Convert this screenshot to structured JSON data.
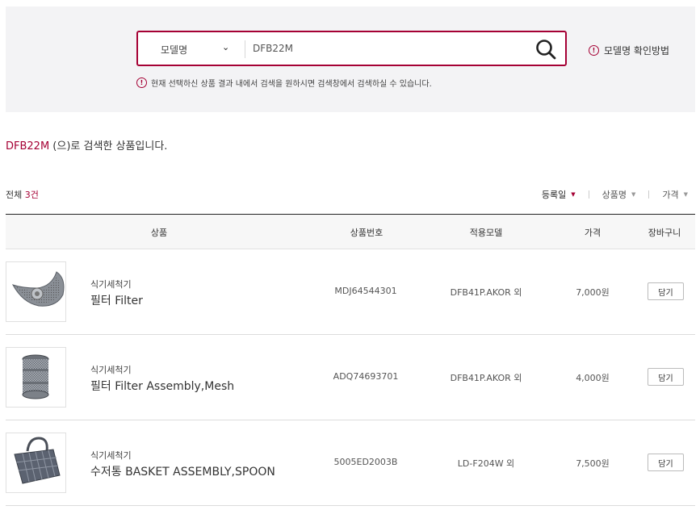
{
  "search": {
    "select_value": "모델명",
    "query": "DFB22M",
    "help_label": "모델명 확인방법",
    "notice": "현재 선택하신 상품 결과 내에서 검색을 원하시면 검색창에서 검색하실 수 있습니다."
  },
  "result": {
    "keyword": "DFB22M",
    "suffix": " (으)로 검색한 상품입니다.",
    "count_prefix": "전체 ",
    "count_value": "3건"
  },
  "sort": [
    {
      "label": "등록일",
      "active": true
    },
    {
      "label": "상품명",
      "active": false
    },
    {
      "label": "가격",
      "active": false
    }
  ],
  "table": {
    "headers": [
      "상품",
      "상품번호",
      "적용모델",
      "가격",
      "장바구니"
    ],
    "rows": [
      {
        "category": "식기세척기",
        "name": "필터 Filter",
        "part_no": "MDJ64544301",
        "model": "DFB41P.AKOR 외",
        "price": "7,000원",
        "cart_label": "담기",
        "image": "filter-disc-icon"
      },
      {
        "category": "식기세척기",
        "name": "필터 Filter Assembly,Mesh",
        "part_no": "ADQ74693701",
        "model": "DFB41P.AKOR 외",
        "price": "4,000원",
        "cart_label": "담기",
        "image": "mesh-filter-icon"
      },
      {
        "category": "식기세척기",
        "name": "수저통 BASKET ASSEMBLY,SPOON",
        "part_no": "5005ED2003B",
        "model": "LD-F204W 외",
        "price": "7,500원",
        "cart_label": "담기",
        "image": "spoon-basket-icon"
      }
    ]
  },
  "colors": {
    "accent": "#a50034"
  }
}
